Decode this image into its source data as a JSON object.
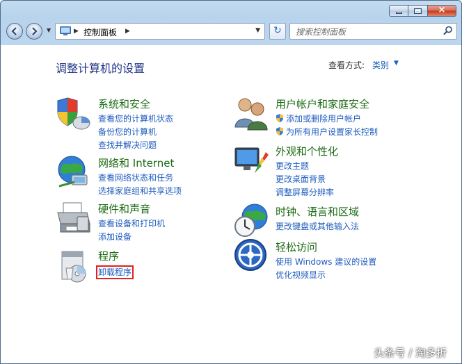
{
  "window": {
    "controls": {
      "minimize": "minimize-icon",
      "maximize": "maximize-icon",
      "close": "×"
    }
  },
  "nav": {
    "breadcrumb": "控制面板",
    "search_placeholder": "搜索控制面板"
  },
  "content": {
    "heading": "调整计算机的设置",
    "view_by_label": "查看方式:",
    "view_by_value": "类别"
  },
  "categories": [
    {
      "title": "系统和安全",
      "links": [
        "查看您的计算机状态",
        "备份您的计算机",
        "查找并解决问题"
      ]
    },
    {
      "title": "网络和 Internet",
      "links": [
        "查看网络状态和任务",
        "选择家庭组和共享选项"
      ]
    },
    {
      "title": "硬件和声音",
      "links": [
        "查看设备和打印机",
        "添加设备"
      ]
    },
    {
      "title": "程序",
      "links": [
        "卸载程序"
      ]
    },
    {
      "title": "用户帐户和家庭安全",
      "links": [
        "添加或删除用户帐户",
        "为所有用户设置家长控制"
      ]
    },
    {
      "title": "外观和个性化",
      "links": [
        "更改主题",
        "更改桌面背景",
        "调整屏幕分辨率"
      ]
    },
    {
      "title": "时钟、语言和区域",
      "links": [
        "更改键盘或其他输入法"
      ]
    },
    {
      "title": "轻松访问",
      "links": [
        "使用 Windows 建议的设置",
        "优化视频显示"
      ]
    }
  ],
  "watermark": "头条号 / 淘多折",
  "colors": {
    "link": "#1e5cbf",
    "category_title": "#1c6b14",
    "heading": "#1e3287",
    "highlight_box": "#e1201f"
  }
}
